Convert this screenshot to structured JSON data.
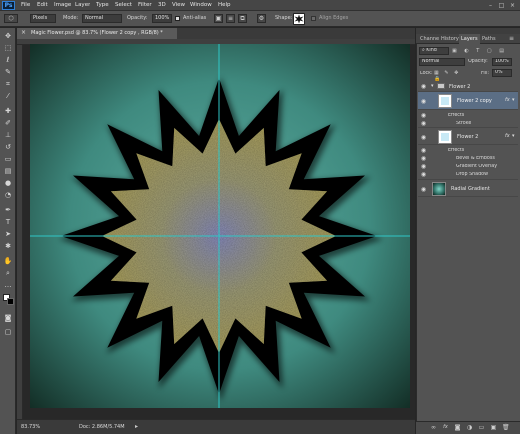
{
  "app": {
    "logo": "Ps"
  },
  "menu": [
    "File",
    "Edit",
    "Image",
    "Layer",
    "Type",
    "Select",
    "Filter",
    "3D",
    "View",
    "Window",
    "Help"
  ],
  "options_bar": {
    "tool_mode": "Pixels",
    "mode_label": "Mode:",
    "mode_value": "Normal",
    "opacity_label": "Opacity:",
    "opacity_value": "100%",
    "antialias_label": "Anti-alias",
    "shape_label": "Shape:",
    "align_edges_label": "Align Edges"
  },
  "document": {
    "tab_title": "Magic Flower.psd @ 83.7% (Flower 2  copy    , RGB/8) *",
    "zoom": "83.73%",
    "doc_size": "Doc: 2.86M/5.74M"
  },
  "panel": {
    "tabs": [
      "Channe",
      "History",
      "Layers",
      "Paths"
    ],
    "active_tab": "Layers",
    "kind_label": "Kind",
    "blend_mode": "Normal",
    "opacity_label": "Opacity:",
    "opacity_value": "100%",
    "lock_label": "Lock:",
    "fill_label": "Fill:",
    "fill_value": "0%",
    "group_name": "Flower 2",
    "layers": [
      {
        "name": "Flower 2  copy",
        "effects_label": "Effects",
        "effects": [
          "Stroke"
        ]
      },
      {
        "name": "Flower 2",
        "effects_label": "Effects",
        "effects": [
          "Bevel & Emboss",
          "Gradient Overlay",
          "Drop Shadow"
        ]
      },
      {
        "name": "Radial Gradient",
        "effects_label": "",
        "effects": []
      }
    ],
    "fx_label": "fx"
  },
  "colors": {
    "bg_teal": "#5aa59a",
    "bg_dark": "#173028",
    "flower_fill": "#a8a466",
    "guide": "#36c4c4",
    "selected_layer": "#5b6e85"
  },
  "icons": [
    "home-icon",
    "move-tool-icon",
    "marquee-icon",
    "lasso-icon",
    "quick-select-icon",
    "crop-icon",
    "eyedropper-icon",
    "brush-icon",
    "stamp-icon",
    "history-brush-icon",
    "eraser-icon",
    "gradient-icon",
    "blur-icon",
    "dodge-icon",
    "pen-icon",
    "type-icon",
    "path-select-icon",
    "shape-icon",
    "hand-icon",
    "zoom-icon",
    "eye-icon",
    "fx-icon"
  ]
}
